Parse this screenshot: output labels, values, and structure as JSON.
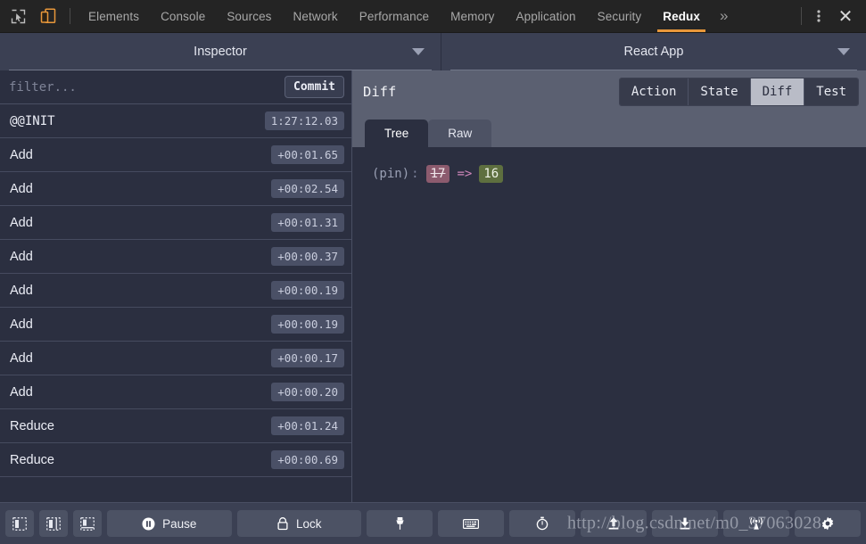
{
  "devtools": {
    "icons": {
      "inspect": "inspect-element-icon",
      "device": "device-toolbar-icon",
      "more_tabs": "»",
      "kebab": "⋮",
      "close": "✕"
    },
    "tabs": [
      {
        "label": "Elements",
        "active": false
      },
      {
        "label": "Console",
        "active": false
      },
      {
        "label": "Sources",
        "active": false
      },
      {
        "label": "Network",
        "active": false
      },
      {
        "label": "Performance",
        "active": false
      },
      {
        "label": "Memory",
        "active": false
      },
      {
        "label": "Application",
        "active": false
      },
      {
        "label": "Security",
        "active": false
      },
      {
        "label": "Redux",
        "active": true
      }
    ],
    "accent_color": "#e8973a"
  },
  "panels": {
    "left_title": "Inspector",
    "right_title": "React App"
  },
  "monitor": {
    "filter_placeholder": "filter...",
    "filter_value": "",
    "commit_label": "Commit",
    "actions": [
      {
        "label": "@@INIT",
        "time": "1:27:12.03",
        "init": true
      },
      {
        "label": "Add",
        "time": "+00:01.65",
        "init": false
      },
      {
        "label": "Add",
        "time": "+00:02.54",
        "init": false
      },
      {
        "label": "Add",
        "time": "+00:01.31",
        "init": false
      },
      {
        "label": "Add",
        "time": "+00:00.37",
        "init": false
      },
      {
        "label": "Add",
        "time": "+00:00.19",
        "init": false
      },
      {
        "label": "Add",
        "time": "+00:00.19",
        "init": false
      },
      {
        "label": "Add",
        "time": "+00:00.17",
        "init": false
      },
      {
        "label": "Add",
        "time": "+00:00.20",
        "init": false
      },
      {
        "label": "Reduce",
        "time": "+00:01.24",
        "init": false
      },
      {
        "label": "Reduce",
        "time": "+00:00.69",
        "init": false
      }
    ]
  },
  "detail": {
    "title": "Diff",
    "view_tabs": [
      {
        "label": "Action",
        "active": false
      },
      {
        "label": "State",
        "active": false
      },
      {
        "label": "Diff",
        "active": true
      },
      {
        "label": "Test",
        "active": false
      }
    ],
    "sub_tabs": [
      {
        "label": "Tree",
        "active": true
      },
      {
        "label": "Raw",
        "active": false
      }
    ],
    "diff": {
      "key": "(pin)",
      "colon": ":",
      "old_value": "17",
      "arrow": "=>",
      "new_value": "16",
      "old_color": "#8c5b6e",
      "new_color": "#5e6f3f",
      "arrow_color": "#cf86ba"
    }
  },
  "toolbar": {
    "buttons": [
      {
        "name": "dock-left-button",
        "icon": "dock-left-icon",
        "label": ""
      },
      {
        "name": "dock-right-button",
        "icon": "dock-right-icon",
        "label": ""
      },
      {
        "name": "dock-bottom-button",
        "icon": "dock-bottom-icon",
        "label": ""
      },
      {
        "name": "pause-button",
        "icon": "pause-circle-icon",
        "label": "Pause"
      },
      {
        "name": "lock-button",
        "icon": "lock-icon",
        "label": "Lock"
      },
      {
        "name": "pin-button",
        "icon": "pin-icon",
        "label": ""
      },
      {
        "name": "keyboard-button",
        "icon": "keyboard-icon",
        "label": ""
      },
      {
        "name": "timer-button",
        "icon": "stopwatch-icon",
        "label": ""
      },
      {
        "name": "upload-button",
        "icon": "upload-icon",
        "label": ""
      },
      {
        "name": "download-button",
        "icon": "download-icon",
        "label": ""
      },
      {
        "name": "broadcast-button",
        "icon": "broadcast-icon",
        "label": ""
      },
      {
        "name": "settings-button",
        "icon": "gear-icon",
        "label": ""
      }
    ]
  },
  "watermark": {
    "text": "http://blog.csdn.net/m0_37063028"
  }
}
